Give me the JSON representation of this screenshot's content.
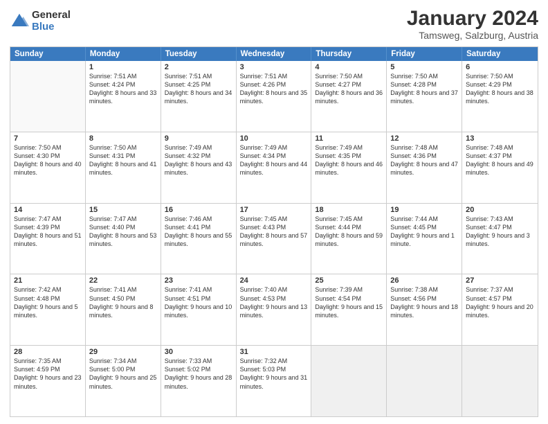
{
  "logo": {
    "general": "General",
    "blue": "Blue"
  },
  "title": "January 2024",
  "subtitle": "Tamsweg, Salzburg, Austria",
  "days": [
    "Sunday",
    "Monday",
    "Tuesday",
    "Wednesday",
    "Thursday",
    "Friday",
    "Saturday"
  ],
  "weeks": [
    [
      {
        "day": "",
        "sunrise": "",
        "sunset": "",
        "daylight": "",
        "empty": true
      },
      {
        "day": "1",
        "sunrise": "Sunrise: 7:51 AM",
        "sunset": "Sunset: 4:24 PM",
        "daylight": "Daylight: 8 hours and 33 minutes.",
        "empty": false
      },
      {
        "day": "2",
        "sunrise": "Sunrise: 7:51 AM",
        "sunset": "Sunset: 4:25 PM",
        "daylight": "Daylight: 8 hours and 34 minutes.",
        "empty": false
      },
      {
        "day": "3",
        "sunrise": "Sunrise: 7:51 AM",
        "sunset": "Sunset: 4:26 PM",
        "daylight": "Daylight: 8 hours and 35 minutes.",
        "empty": false
      },
      {
        "day": "4",
        "sunrise": "Sunrise: 7:50 AM",
        "sunset": "Sunset: 4:27 PM",
        "daylight": "Daylight: 8 hours and 36 minutes.",
        "empty": false
      },
      {
        "day": "5",
        "sunrise": "Sunrise: 7:50 AM",
        "sunset": "Sunset: 4:28 PM",
        "daylight": "Daylight: 8 hours and 37 minutes.",
        "empty": false
      },
      {
        "day": "6",
        "sunrise": "Sunrise: 7:50 AM",
        "sunset": "Sunset: 4:29 PM",
        "daylight": "Daylight: 8 hours and 38 minutes.",
        "empty": false
      }
    ],
    [
      {
        "day": "7",
        "sunrise": "Sunrise: 7:50 AM",
        "sunset": "Sunset: 4:30 PM",
        "daylight": "Daylight: 8 hours and 40 minutes.",
        "empty": false
      },
      {
        "day": "8",
        "sunrise": "Sunrise: 7:50 AM",
        "sunset": "Sunset: 4:31 PM",
        "daylight": "Daylight: 8 hours and 41 minutes.",
        "empty": false
      },
      {
        "day": "9",
        "sunrise": "Sunrise: 7:49 AM",
        "sunset": "Sunset: 4:32 PM",
        "daylight": "Daylight: 8 hours and 43 minutes.",
        "empty": false
      },
      {
        "day": "10",
        "sunrise": "Sunrise: 7:49 AM",
        "sunset": "Sunset: 4:34 PM",
        "daylight": "Daylight: 8 hours and 44 minutes.",
        "empty": false
      },
      {
        "day": "11",
        "sunrise": "Sunrise: 7:49 AM",
        "sunset": "Sunset: 4:35 PM",
        "daylight": "Daylight: 8 hours and 46 minutes.",
        "empty": false
      },
      {
        "day": "12",
        "sunrise": "Sunrise: 7:48 AM",
        "sunset": "Sunset: 4:36 PM",
        "daylight": "Daylight: 8 hours and 47 minutes.",
        "empty": false
      },
      {
        "day": "13",
        "sunrise": "Sunrise: 7:48 AM",
        "sunset": "Sunset: 4:37 PM",
        "daylight": "Daylight: 8 hours and 49 minutes.",
        "empty": false
      }
    ],
    [
      {
        "day": "14",
        "sunrise": "Sunrise: 7:47 AM",
        "sunset": "Sunset: 4:39 PM",
        "daylight": "Daylight: 8 hours and 51 minutes.",
        "empty": false
      },
      {
        "day": "15",
        "sunrise": "Sunrise: 7:47 AM",
        "sunset": "Sunset: 4:40 PM",
        "daylight": "Daylight: 8 hours and 53 minutes.",
        "empty": false
      },
      {
        "day": "16",
        "sunrise": "Sunrise: 7:46 AM",
        "sunset": "Sunset: 4:41 PM",
        "daylight": "Daylight: 8 hours and 55 minutes.",
        "empty": false
      },
      {
        "day": "17",
        "sunrise": "Sunrise: 7:45 AM",
        "sunset": "Sunset: 4:43 PM",
        "daylight": "Daylight: 8 hours and 57 minutes.",
        "empty": false
      },
      {
        "day": "18",
        "sunrise": "Sunrise: 7:45 AM",
        "sunset": "Sunset: 4:44 PM",
        "daylight": "Daylight: 8 hours and 59 minutes.",
        "empty": false
      },
      {
        "day": "19",
        "sunrise": "Sunrise: 7:44 AM",
        "sunset": "Sunset: 4:45 PM",
        "daylight": "Daylight: 9 hours and 1 minute.",
        "empty": false
      },
      {
        "day": "20",
        "sunrise": "Sunrise: 7:43 AM",
        "sunset": "Sunset: 4:47 PM",
        "daylight": "Daylight: 9 hours and 3 minutes.",
        "empty": false
      }
    ],
    [
      {
        "day": "21",
        "sunrise": "Sunrise: 7:42 AM",
        "sunset": "Sunset: 4:48 PM",
        "daylight": "Daylight: 9 hours and 5 minutes.",
        "empty": false
      },
      {
        "day": "22",
        "sunrise": "Sunrise: 7:41 AM",
        "sunset": "Sunset: 4:50 PM",
        "daylight": "Daylight: 9 hours and 8 minutes.",
        "empty": false
      },
      {
        "day": "23",
        "sunrise": "Sunrise: 7:41 AM",
        "sunset": "Sunset: 4:51 PM",
        "daylight": "Daylight: 9 hours and 10 minutes.",
        "empty": false
      },
      {
        "day": "24",
        "sunrise": "Sunrise: 7:40 AM",
        "sunset": "Sunset: 4:53 PM",
        "daylight": "Daylight: 9 hours and 13 minutes.",
        "empty": false
      },
      {
        "day": "25",
        "sunrise": "Sunrise: 7:39 AM",
        "sunset": "Sunset: 4:54 PM",
        "daylight": "Daylight: 9 hours and 15 minutes.",
        "empty": false
      },
      {
        "day": "26",
        "sunrise": "Sunrise: 7:38 AM",
        "sunset": "Sunset: 4:56 PM",
        "daylight": "Daylight: 9 hours and 18 minutes.",
        "empty": false
      },
      {
        "day": "27",
        "sunrise": "Sunrise: 7:37 AM",
        "sunset": "Sunset: 4:57 PM",
        "daylight": "Daylight: 9 hours and 20 minutes.",
        "empty": false
      }
    ],
    [
      {
        "day": "28",
        "sunrise": "Sunrise: 7:35 AM",
        "sunset": "Sunset: 4:59 PM",
        "daylight": "Daylight: 9 hours and 23 minutes.",
        "empty": false
      },
      {
        "day": "29",
        "sunrise": "Sunrise: 7:34 AM",
        "sunset": "Sunset: 5:00 PM",
        "daylight": "Daylight: 9 hours and 25 minutes.",
        "empty": false
      },
      {
        "day": "30",
        "sunrise": "Sunrise: 7:33 AM",
        "sunset": "Sunset: 5:02 PM",
        "daylight": "Daylight: 9 hours and 28 minutes.",
        "empty": false
      },
      {
        "day": "31",
        "sunrise": "Sunrise: 7:32 AM",
        "sunset": "Sunset: 5:03 PM",
        "daylight": "Daylight: 9 hours and 31 minutes.",
        "empty": false
      },
      {
        "day": "",
        "sunrise": "",
        "sunset": "",
        "daylight": "",
        "empty": true
      },
      {
        "day": "",
        "sunrise": "",
        "sunset": "",
        "daylight": "",
        "empty": true
      },
      {
        "day": "",
        "sunrise": "",
        "sunset": "",
        "daylight": "",
        "empty": true
      }
    ]
  ]
}
